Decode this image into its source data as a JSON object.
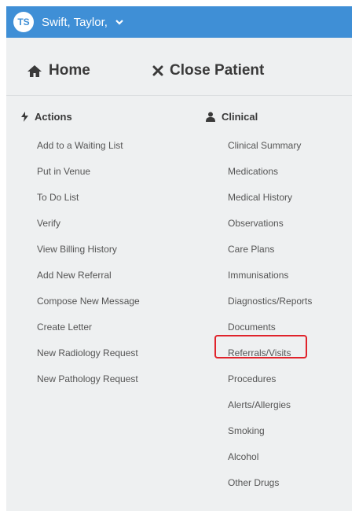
{
  "user": {
    "initials": "TS",
    "name": "Swift, Taylor,"
  },
  "nav": {
    "home_label": "Home",
    "close_label": "Close Patient"
  },
  "actions": {
    "title": "Actions",
    "items": [
      "Add to a Waiting List",
      "Put in Venue",
      "To Do List",
      "Verify",
      "View Billing History",
      "Add New Referral",
      "Compose New Message",
      "Create Letter",
      "New Radiology Request",
      "New Pathology Request"
    ]
  },
  "clinical": {
    "title": "Clinical",
    "items": [
      "Clinical Summary",
      "Medications",
      "Medical History",
      "Observations",
      "Care Plans",
      "Immunisations",
      "Diagnostics/Reports",
      "Documents",
      "Referrals/Visits",
      "Procedures",
      "Alerts/Allergies",
      "Smoking",
      "Alcohol",
      "Other Drugs"
    ],
    "highlighted": "Documents"
  },
  "colors": {
    "topbar": "#3f8fd6",
    "panel": "#eef0f1",
    "highlight": "#e0232b"
  },
  "icons": {
    "home": "home-icon",
    "close": "close-icon",
    "actions": "bolt-icon",
    "clinical": "user-icon",
    "caret": "chevron-down-icon"
  }
}
